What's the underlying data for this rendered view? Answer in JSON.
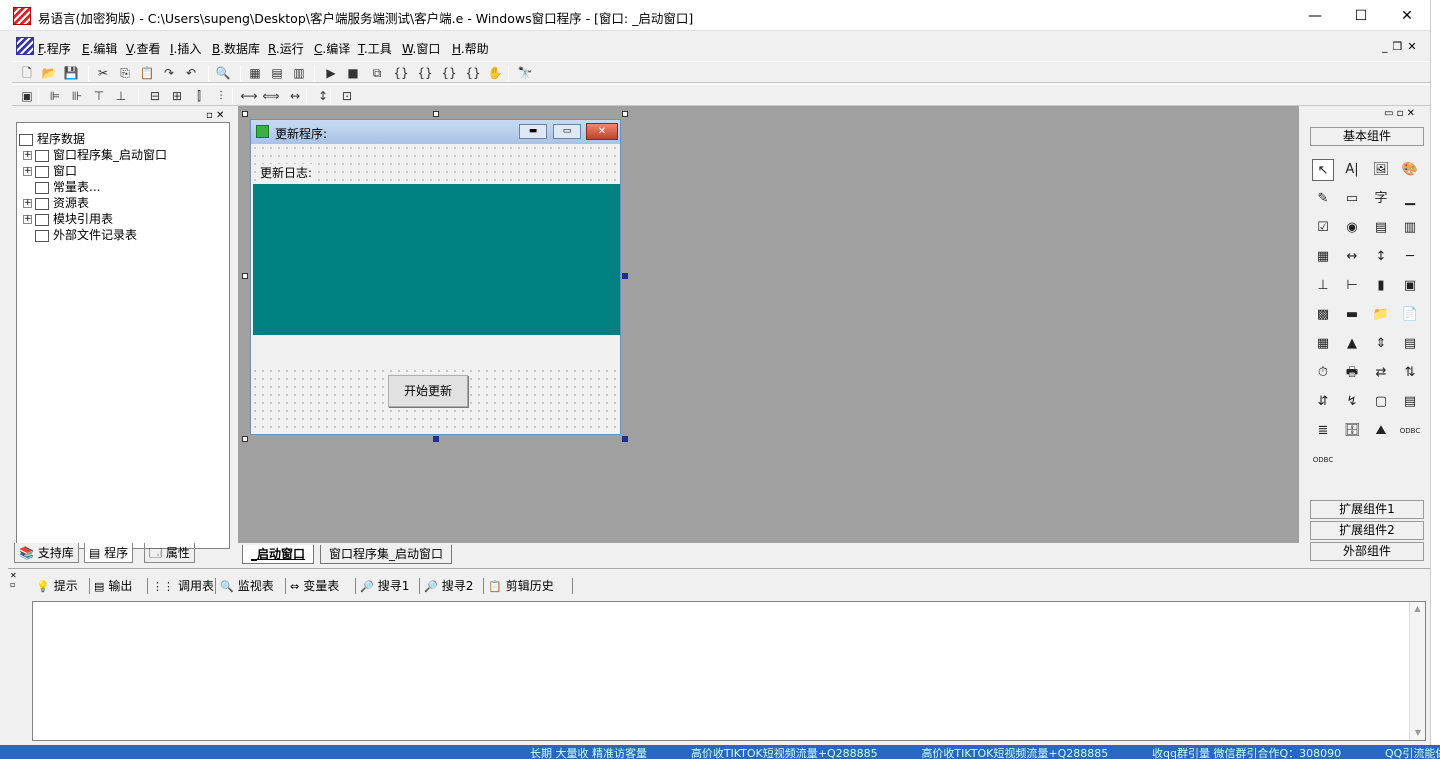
{
  "window": {
    "title": "易语言(加密狗版) - C:\\Users\\supeng\\Desktop\\客户端服务端测试\\客户端.e - Windows窗口程序 - [窗口: _启动窗口]",
    "minimize_glyph": "—",
    "maximize_glyph": "☐",
    "close_glyph": "✕"
  },
  "menubar": {
    "items": [
      {
        "key": "F",
        "label": ".程序"
      },
      {
        "key": "E",
        "label": ".编辑"
      },
      {
        "key": "V",
        "label": ".查看"
      },
      {
        "key": "I",
        "label": ".插入"
      },
      {
        "key": "B",
        "label": ".数据库"
      },
      {
        "key": "R",
        "label": ".运行"
      },
      {
        "key": "C",
        "label": ".编译"
      },
      {
        "key": "T",
        "label": ".工具"
      },
      {
        "key": "W",
        "label": ".窗口"
      },
      {
        "key": "H",
        "label": ".帮助"
      }
    ],
    "mdi_controls": [
      "_",
      "❐",
      "✕"
    ]
  },
  "toolbar1": {
    "icons": [
      "new-file-icon",
      "open-folder-icon",
      "save-icon",
      "cut-icon",
      "copy-icon",
      "paste-icon",
      "redo-icon",
      "undo-icon",
      "find-icon",
      "layout1-icon",
      "layout2-icon",
      "layout3-icon",
      "run-icon",
      "stop-icon",
      "step-icon",
      "step-into-icon",
      "step-out-icon",
      "step-over-icon",
      "breakpoint-icon",
      "hand-icon",
      "find-replace-icon"
    ],
    "glyphs": [
      "🗋",
      "📂",
      "💾",
      "✂",
      "⎘",
      "📋",
      "↷",
      "↶",
      "🔍",
      "▦",
      "▤",
      "▥",
      "▶",
      "■",
      "⧉",
      "{}",
      "{}",
      "{}",
      "{}",
      "✋",
      "🔭"
    ]
  },
  "toolbar2": {
    "icons": [
      "calc-icon",
      "align-left-icon",
      "align-center-icon",
      "align-top-icon",
      "align-bottom-icon",
      "space-h-icon",
      "space-v-icon",
      "center-h-icon",
      "center-v-icon",
      "equal-width-icon",
      "equal-height-icon",
      "same-size-icon",
      "grid-icon",
      "lock-icon"
    ],
    "glyphs": [
      "▣",
      "⊫",
      "⊪",
      "⊤",
      "⊥",
      "⊟",
      "⊞",
      "⫿",
      "⫶",
      "⟷",
      "⟺",
      "↔",
      "↕",
      "⊡"
    ]
  },
  "left_panel": {
    "tree": [
      {
        "label": "程序数据",
        "indent": 0,
        "expander": ""
      },
      {
        "label": "窗口程序集_启动窗口",
        "indent": 1,
        "expander": "+"
      },
      {
        "label": "窗口",
        "indent": 1,
        "expander": "+"
      },
      {
        "label": "常量表...",
        "indent": 1,
        "expander": ""
      },
      {
        "label": "资源表",
        "indent": 1,
        "expander": "+"
      },
      {
        "label": "模块引用表",
        "indent": 1,
        "expander": "+"
      },
      {
        "label": "外部文件记录表",
        "indent": 1,
        "expander": ""
      }
    ],
    "tabs": [
      "支持库",
      "程序",
      "属性"
    ]
  },
  "form": {
    "title": "更新程序:",
    "log_label": "更新日志:",
    "button_label": "开始更新"
  },
  "doc_tabs": [
    "_启动窗口",
    "窗口程序集_启动窗口"
  ],
  "palette": {
    "header": "基本组件",
    "footer_buttons": [
      "扩展组件1",
      "扩展组件2",
      "外部组件"
    ],
    "component_glyphs": [
      "↖",
      "A|",
      "🖼",
      "🎨",
      "✎",
      "▭",
      "字",
      "▁",
      "☑",
      "◉",
      "▤",
      "▥",
      "▦",
      "↔",
      "↕",
      "─",
      "⊥",
      "⊢",
      "▮",
      "▣",
      "▩",
      "▬",
      "📁",
      "📄",
      "▦",
      "▲",
      "⇕",
      "▤",
      "⏱",
      "🖶",
      "⇄",
      "⇅",
      "⇵",
      "↯",
      "▢",
      "▤",
      "≣",
      "🗄",
      "⛰",
      "ODBC",
      "ODBC"
    ]
  },
  "output": {
    "tabs": [
      {
        "icon": "hint-icon",
        "glyph": "💡",
        "label": "提示"
      },
      {
        "icon": "output-icon",
        "glyph": "▤",
        "label": "输出"
      },
      {
        "icon": "calltable-icon",
        "glyph": "⋮⋮",
        "label": "调用表"
      },
      {
        "icon": "watch-icon",
        "glyph": "🔍",
        "label": "监视表"
      },
      {
        "icon": "vartable-icon",
        "glyph": "⇔",
        "label": "变量表"
      },
      {
        "icon": "search1-icon",
        "glyph": "🔎",
        "label": "搜寻1"
      },
      {
        "icon": "search2-icon",
        "glyph": "🔎",
        "label": "搜寻2"
      },
      {
        "icon": "clipboard-icon",
        "glyph": "📋",
        "label": "剪辑历史"
      }
    ]
  },
  "background_strip": [
    "长期 大量收 精准访客量",
    "高价收TIKTOK短视频流量+Q288885",
    "高价收TIKTOK短视频流量+Q288885",
    "收qq群引量 微信群引合作Q：308090",
    "QQ引流能做的加Q"
  ]
}
